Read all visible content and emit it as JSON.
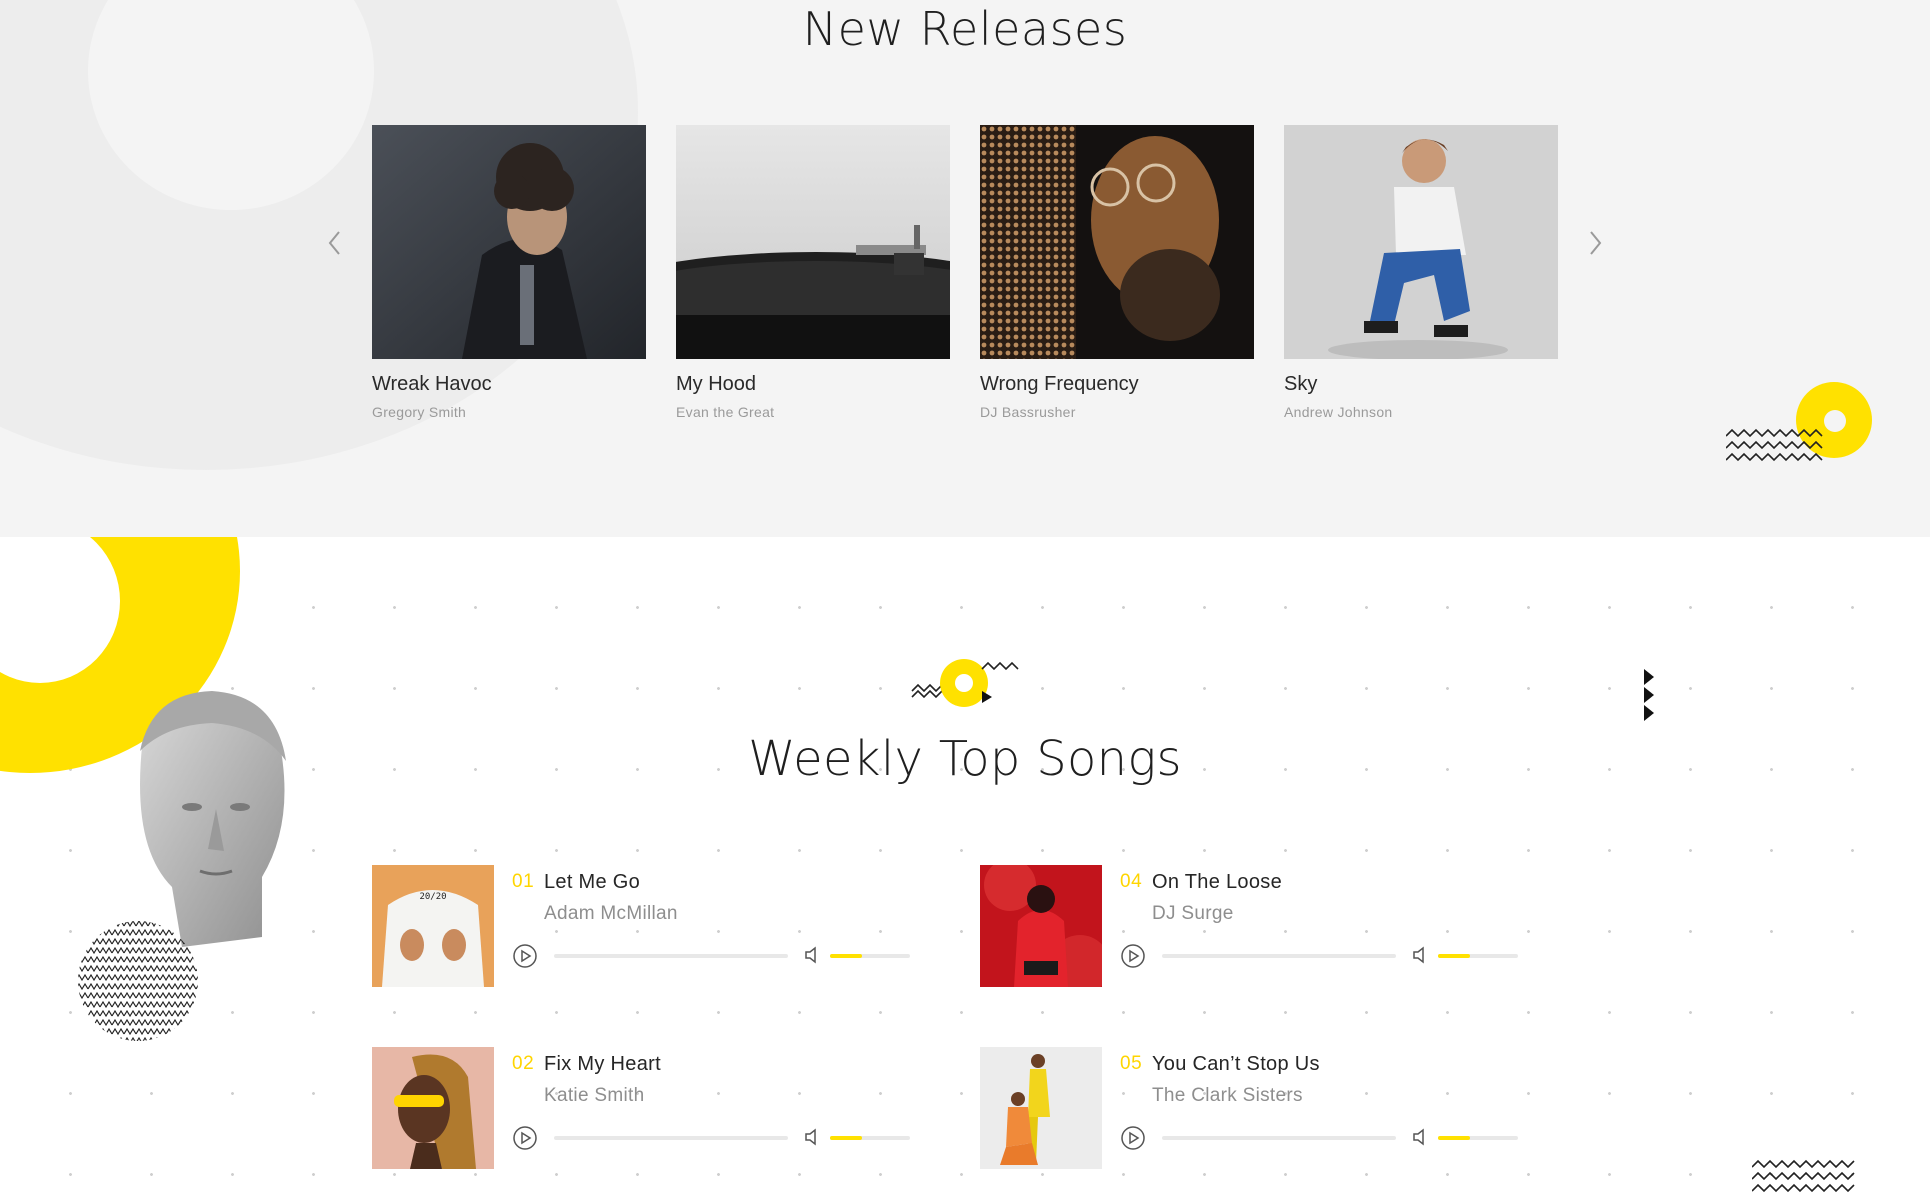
{
  "new_releases": {
    "title": "New Releases",
    "albums": [
      {
        "title": "Wreak Havoc",
        "artist": "Gregory Smith"
      },
      {
        "title": "My Hood",
        "artist": "Evan the Great"
      },
      {
        "title": "Wrong Frequency",
        "artist": "DJ Bassrusher"
      },
      {
        "title": "Sky",
        "artist": "Andrew Johnson"
      }
    ]
  },
  "weekly_top_songs": {
    "title": "Weekly Top Songs",
    "songs": [
      {
        "number": "01",
        "title": "Let Me Go",
        "artist": "Adam McMillan",
        "progress": 0,
        "volume": 0.4
      },
      {
        "number": "02",
        "title": "Fix My Heart",
        "artist": "Katie Smith",
        "progress": 0,
        "volume": 0.4
      },
      {
        "number": "04",
        "title": "On The Loose",
        "artist": "DJ Surge",
        "progress": 0,
        "volume": 0.4
      },
      {
        "number": "05",
        "title": "You Can’t Stop Us",
        "artist": "The Clark Sisters",
        "progress": 0,
        "volume": 0.4
      }
    ]
  },
  "colors": {
    "accent": "#ffe100",
    "number_accent": "#ffd500",
    "release_bg": "#f4f4f4",
    "page_bg": "#ffffff"
  },
  "icons": {
    "prev": "chevron-left-icon",
    "next": "chevron-right-icon",
    "play": "play-circle-icon",
    "volume": "speaker-icon"
  }
}
